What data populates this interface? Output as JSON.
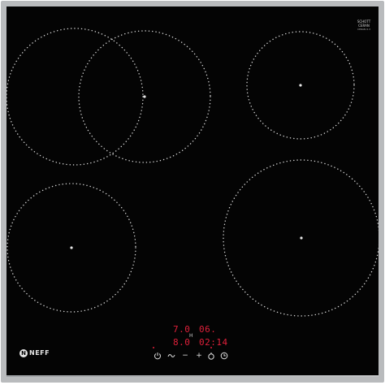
{
  "appliance": {
    "brand": "NEFF",
    "brand_initial": "N",
    "glass_maker": "SCHOTT CERAN",
    "glass_small_print": "CERAN 6.3"
  },
  "display": {
    "top_left": "7.0",
    "top_right": "06.",
    "bottom_left": "8.0",
    "bottom_right": "02:14",
    "indicator": "H"
  },
  "controls": {
    "power_icon": "power-icon",
    "wipe_protect_icon": "wipe-protect-icon",
    "minus_label": "−",
    "plus_label": "+",
    "timer_icon": "timer-icon",
    "clock_icon": "clock-icon"
  },
  "zones": [
    {
      "name": "cooking-zone-rear-left-outer"
    },
    {
      "name": "cooking-zone-rear-left-inner"
    },
    {
      "name": "cooking-zone-rear-right"
    },
    {
      "name": "cooking-zone-front-left"
    },
    {
      "name": "cooking-zone-front-right"
    }
  ]
}
